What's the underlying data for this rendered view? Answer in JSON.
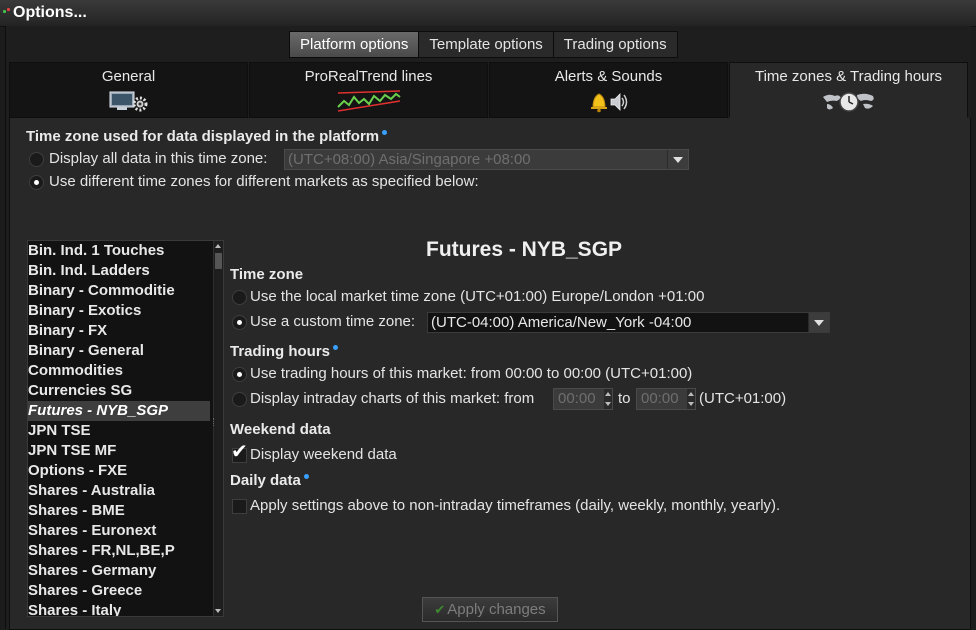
{
  "window": {
    "title": "Options..."
  },
  "top_tabs": [
    {
      "label": "Platform options",
      "active": true
    },
    {
      "label": "Template options",
      "active": false
    },
    {
      "label": "Trading options",
      "active": false
    }
  ],
  "main_tabs": [
    {
      "label": "General",
      "icon": "monitor-gear-icon",
      "active": false
    },
    {
      "label": "ProRealTrend lines",
      "icon": "trend-chart-icon",
      "active": false
    },
    {
      "label": "Alerts & Sounds",
      "icon": "bell-speaker-icon",
      "active": false
    },
    {
      "label": "Time zones & Trading hours",
      "icon": "globe-clock-icon",
      "active": true
    }
  ],
  "timezone_section": {
    "heading": "Time zone used for data displayed in the platform",
    "option_all_label": "Display all data in this time zone:",
    "option_all_value": "(UTC+08:00) Asia/Singapore +08:00",
    "option_different_label": "Use different time zones for different markets as specified below:"
  },
  "markets": [
    "Bin. Ind. 1 Touches",
    "Bin. Ind. Ladders",
    "Binary - Commoditie",
    "Binary - Exotics",
    "Binary - FX",
    "Binary - General",
    "Commodities",
    "Currencies SG",
    "Futures - NYB_SGP",
    "JPN TSE",
    "JPN TSE MF",
    "Options - FXE",
    "Shares - Australia",
    "Shares - BME",
    "Shares - Euronext",
    "Shares - FR,NL,BE,P",
    "Shares - Germany",
    "Shares - Greece",
    "Shares - Italy"
  ],
  "selected_market": "Futures - NYB_SGP",
  "detail": {
    "title": "Futures - NYB_SGP",
    "timezone_heading": "Time zone",
    "local_tz_label": "Use the local market time zone (UTC+01:00) Europe/London +01:00",
    "custom_tz_label": "Use a custom time zone:",
    "custom_tz_value": "(UTC-04:00) America/New_York -04:00",
    "trading_hours_heading": "Trading hours",
    "use_hours_label": "Use trading hours of this market: from 00:00 to 00:00 (UTC+01:00)",
    "intraday_label": "Display intraday charts of this market: from",
    "intraday_from": "00:00",
    "intraday_to_label": "to",
    "intraday_to": "00:00",
    "intraday_tz": "(UTC+01:00)",
    "weekend_heading": "Weekend data",
    "weekend_label": "Display weekend data",
    "daily_heading": "Daily data",
    "daily_label": "Apply settings above to non-intraday timeframes (daily, weekly, monthly, yearly)."
  },
  "apply_button": "Apply changes"
}
